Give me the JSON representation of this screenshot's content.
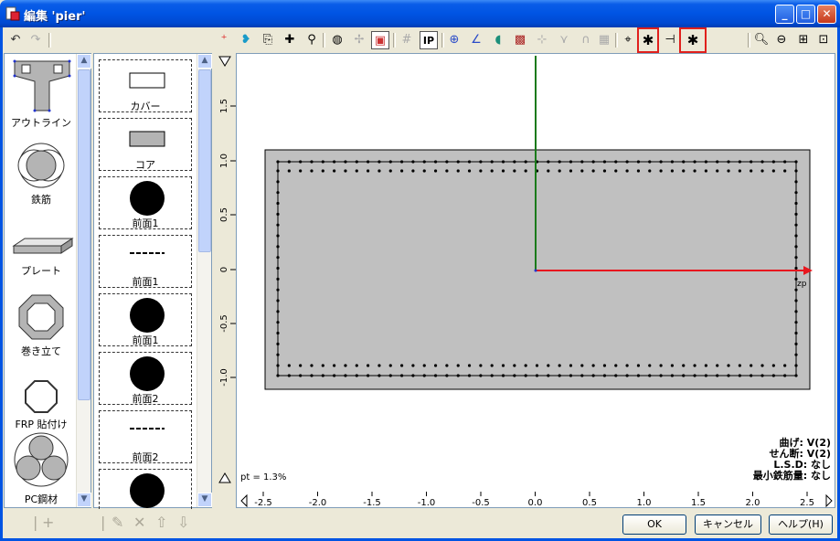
{
  "window": {
    "title": "編集 'pier'"
  },
  "outline_palette": [
    {
      "label": "アウトライン",
      "icon": "pier-outline-icon"
    },
    {
      "label": "鉄筋",
      "icon": "rebar-icon"
    },
    {
      "label": "プレート",
      "icon": "plate-icon"
    },
    {
      "label": "巻き立て",
      "icon": "jacket-icon"
    },
    {
      "label": "FRP 貼付け",
      "icon": "frp-icon"
    },
    {
      "label": "PC鋼材",
      "icon": "pc-steel-icon"
    }
  ],
  "layer_list": [
    {
      "label": "カバー",
      "icon": "cover-rect-icon"
    },
    {
      "label": "コア",
      "icon": "core-rect-icon"
    },
    {
      "label": "前面1",
      "icon": "filled-circle-icon"
    },
    {
      "label": "前面1",
      "icon": "dashed-line-icon"
    },
    {
      "label": "前面1",
      "icon": "filled-circle-icon"
    },
    {
      "label": "前面2",
      "icon": "filled-circle-icon"
    },
    {
      "label": "前面2",
      "icon": "dashed-line-icon"
    },
    {
      "label": "",
      "icon": "filled-circle-icon"
    }
  ],
  "canvas": {
    "y_ticks": [
      "1.5",
      "1.0",
      "0.5",
      "0",
      "-0.5",
      "-1.0"
    ],
    "x_ticks": [
      "-2.5",
      "-2.0",
      "-1.5",
      "-1.0",
      "-0.5",
      "0.0",
      "0.5",
      "1.0",
      "1.5",
      "2.0",
      "2.5"
    ],
    "axis_label": "zp",
    "pt_label": "pt = 1.3%",
    "status_lines": [
      "曲げ: V(2)",
      "せん断: V(2)",
      "L.S.D: なし",
      "最小鉄筋量: なし"
    ]
  },
  "buttons": {
    "ok": "OK",
    "cancel": "キャンセル",
    "help": "ヘルプ(H)"
  },
  "colors": {
    "title_blue": "#0054e3",
    "section_fill": "#c0c0c0",
    "axis_x": "#e8171f",
    "axis_y": "#1a7a1a",
    "highlight": "#e0201c"
  }
}
